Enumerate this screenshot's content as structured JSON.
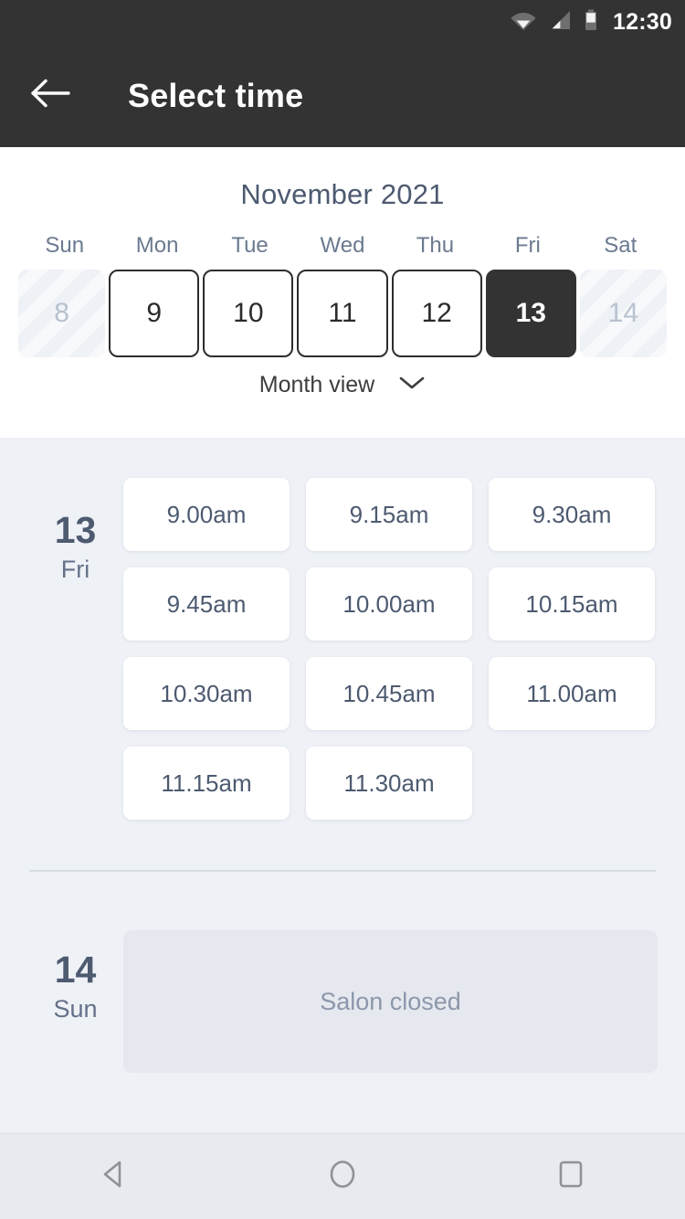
{
  "status_bar": {
    "time": "12:30",
    "icons": [
      "wifi-icon",
      "cellular-signal-icon",
      "battery-icon"
    ]
  },
  "app_bar": {
    "back_icon": "back-arrow-icon",
    "title": "Select time"
  },
  "calendar": {
    "month_title": "November 2021",
    "weekday_headers": [
      "Sun",
      "Mon",
      "Tue",
      "Wed",
      "Thu",
      "Fri",
      "Sat"
    ],
    "days": [
      {
        "number": "8",
        "state": "disabled"
      },
      {
        "number": "9",
        "state": "available"
      },
      {
        "number": "10",
        "state": "available"
      },
      {
        "number": "11",
        "state": "available"
      },
      {
        "number": "12",
        "state": "available"
      },
      {
        "number": "13",
        "state": "selected"
      },
      {
        "number": "14",
        "state": "disabled"
      }
    ],
    "view_toggle_label": "Month view",
    "view_toggle_icon": "chevron-down-icon"
  },
  "schedule": {
    "groups": [
      {
        "day_number": "13",
        "day_of_week": "Fri",
        "closed": false,
        "slots": [
          "9.00am",
          "9.15am",
          "9.30am",
          "9.45am",
          "10.00am",
          "10.15am",
          "10.30am",
          "10.45am",
          "11.00am",
          "11.15am",
          "11.30am"
        ]
      },
      {
        "day_number": "14",
        "day_of_week": "Sun",
        "closed": true,
        "closed_message": "Salon closed",
        "slots": []
      }
    ]
  },
  "nav_bar": {
    "buttons": [
      {
        "icon": "android-back-icon"
      },
      {
        "icon": "android-home-icon"
      },
      {
        "icon": "android-recents-icon"
      }
    ]
  },
  "colors": {
    "app_bar_bg": "#333333",
    "content_bg": "#eef1f6",
    "card_bg": "#ffffff",
    "text_slate": "#4d5a70",
    "selected_day_bg": "#333333",
    "closed_panel_bg": "#e5e8ee",
    "nav_bar_bg": "#e7eaee"
  }
}
